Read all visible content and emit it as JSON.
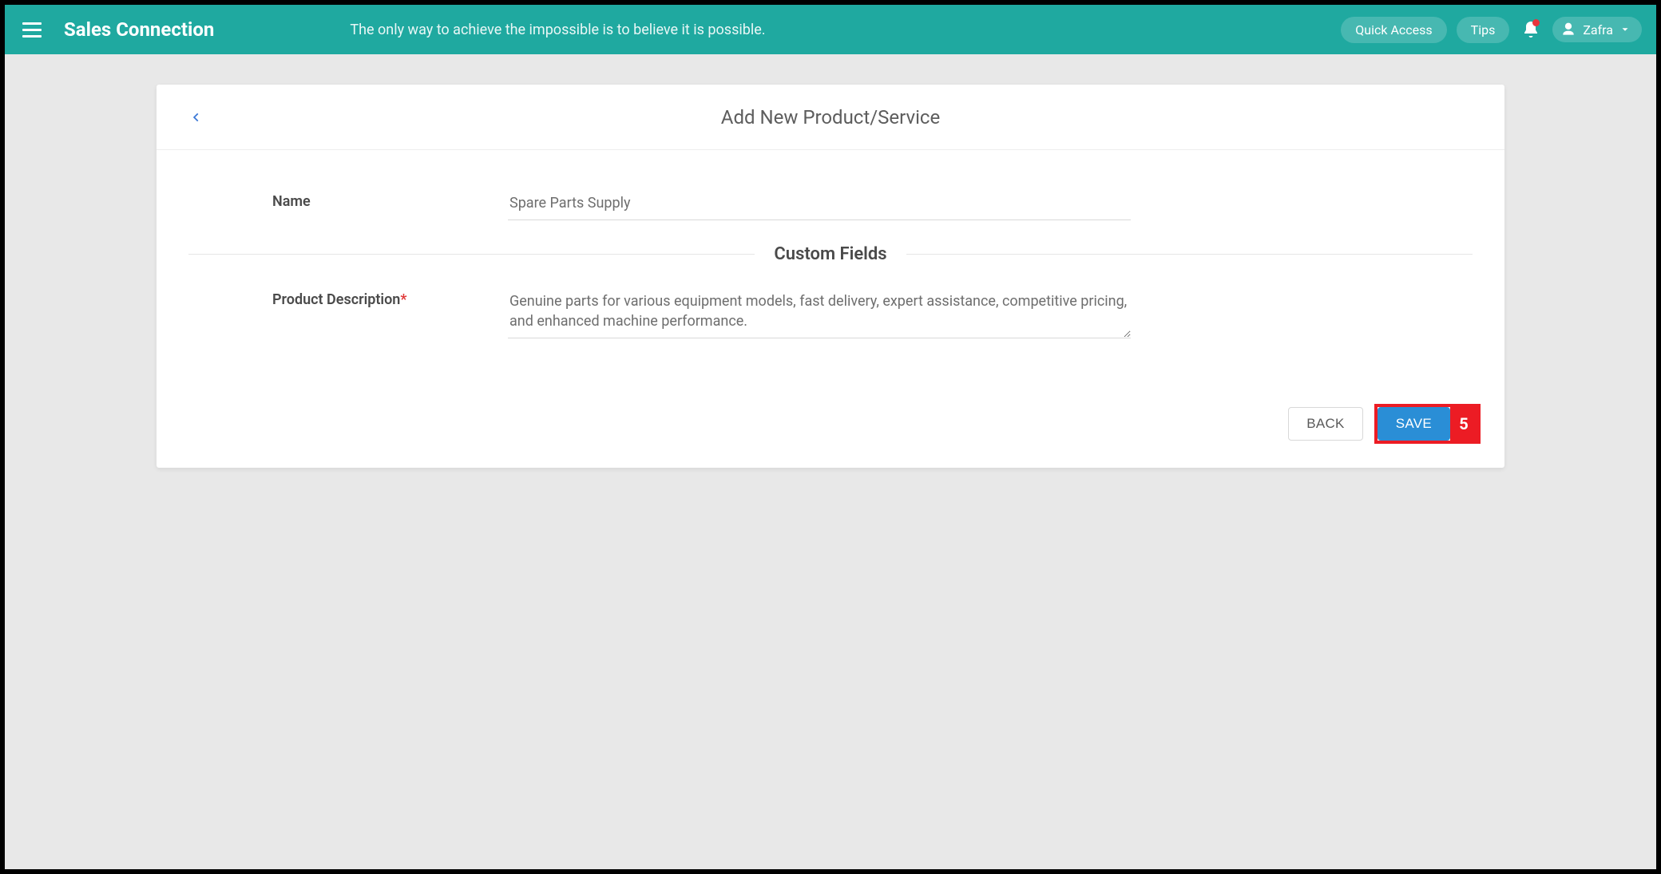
{
  "header": {
    "app_title": "Sales Connection",
    "tagline": "The only way to achieve the impossible is to believe it is possible.",
    "quick_access_label": "Quick Access",
    "tips_label": "Tips",
    "user_name": "Zafra"
  },
  "page": {
    "title": "Add New Product/Service",
    "custom_fields_heading": "Custom Fields"
  },
  "form": {
    "name_label": "Name",
    "name_value": "Spare Parts Supply",
    "description_label": "Product Description",
    "description_value": "Genuine parts for various equipment models, fast delivery, expert assistance, competitive pricing, and enhanced machine performance."
  },
  "actions": {
    "back_label": "BACK",
    "save_label": "SAVE"
  },
  "annotation": {
    "badge": "5"
  }
}
